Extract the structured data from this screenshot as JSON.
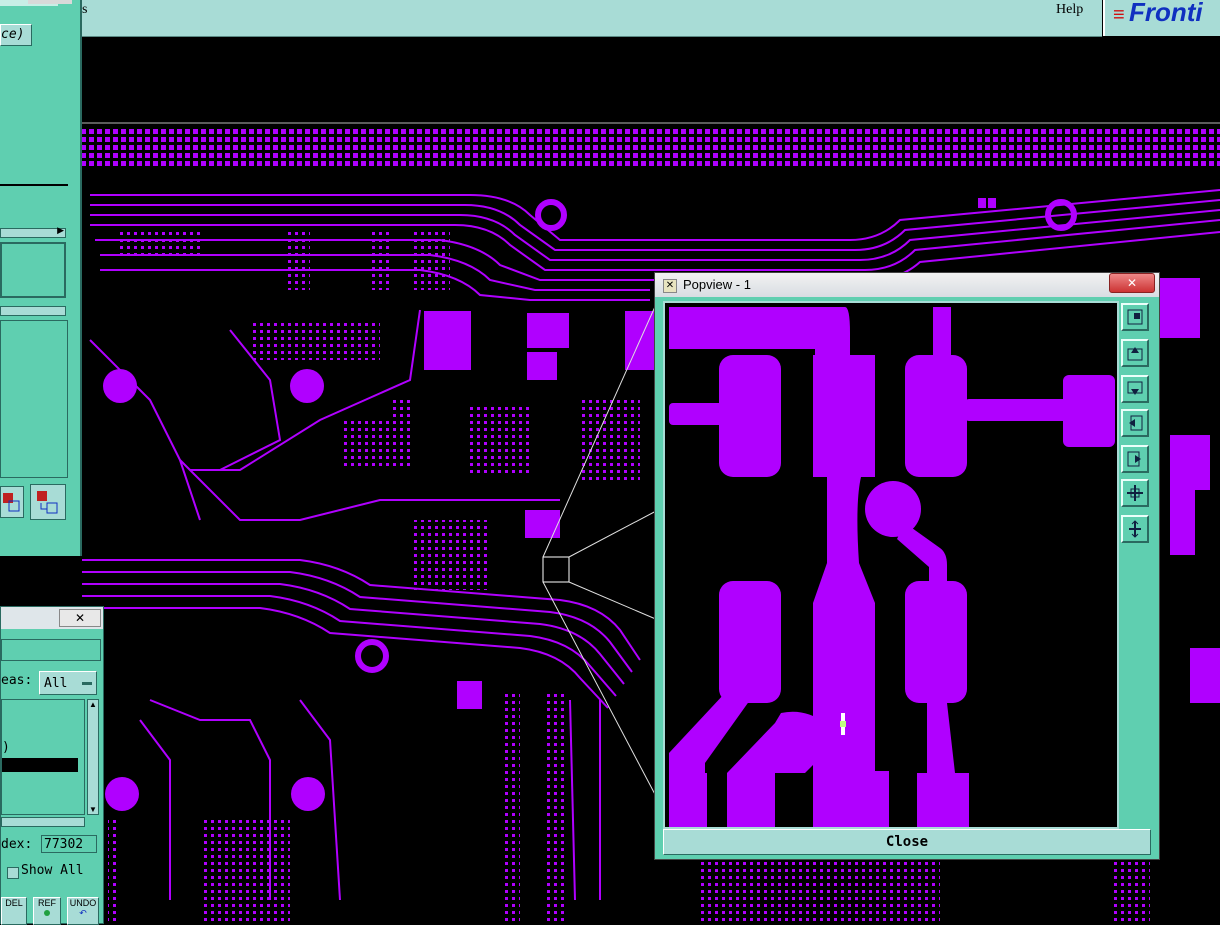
{
  "menubar": {
    "fragment": "s",
    "help": "Help",
    "brand": "Fronti"
  },
  "left_panel_top": {
    "field_fragment": "ce)"
  },
  "popview": {
    "title": "Popview - 1",
    "close_label": "Close",
    "toolbar": [
      {
        "icon": "zoom-fit-icon"
      },
      {
        "icon": "pan-up-icon"
      },
      {
        "icon": "pan-down-icon"
      },
      {
        "icon": "pan-left-icon"
      },
      {
        "icon": "pan-right-icon"
      },
      {
        "icon": "zoom-in-icon"
      },
      {
        "icon": "zoom-out-icon"
      }
    ]
  },
  "left_panel_bottom": {
    "areas_label": "eas:",
    "areas_value": "All",
    "list_fragment": ")",
    "index_label": "dex:",
    "index_value": "77302",
    "show_all_label": "Show All",
    "buttons": [
      {
        "label": "DEL"
      },
      {
        "label": "REF"
      },
      {
        "label": "UNDO"
      }
    ]
  },
  "colors": {
    "trace": "#b000ff",
    "panel": "#5fcfb0",
    "menubar": "#a8dcd6",
    "background": "#000000"
  }
}
